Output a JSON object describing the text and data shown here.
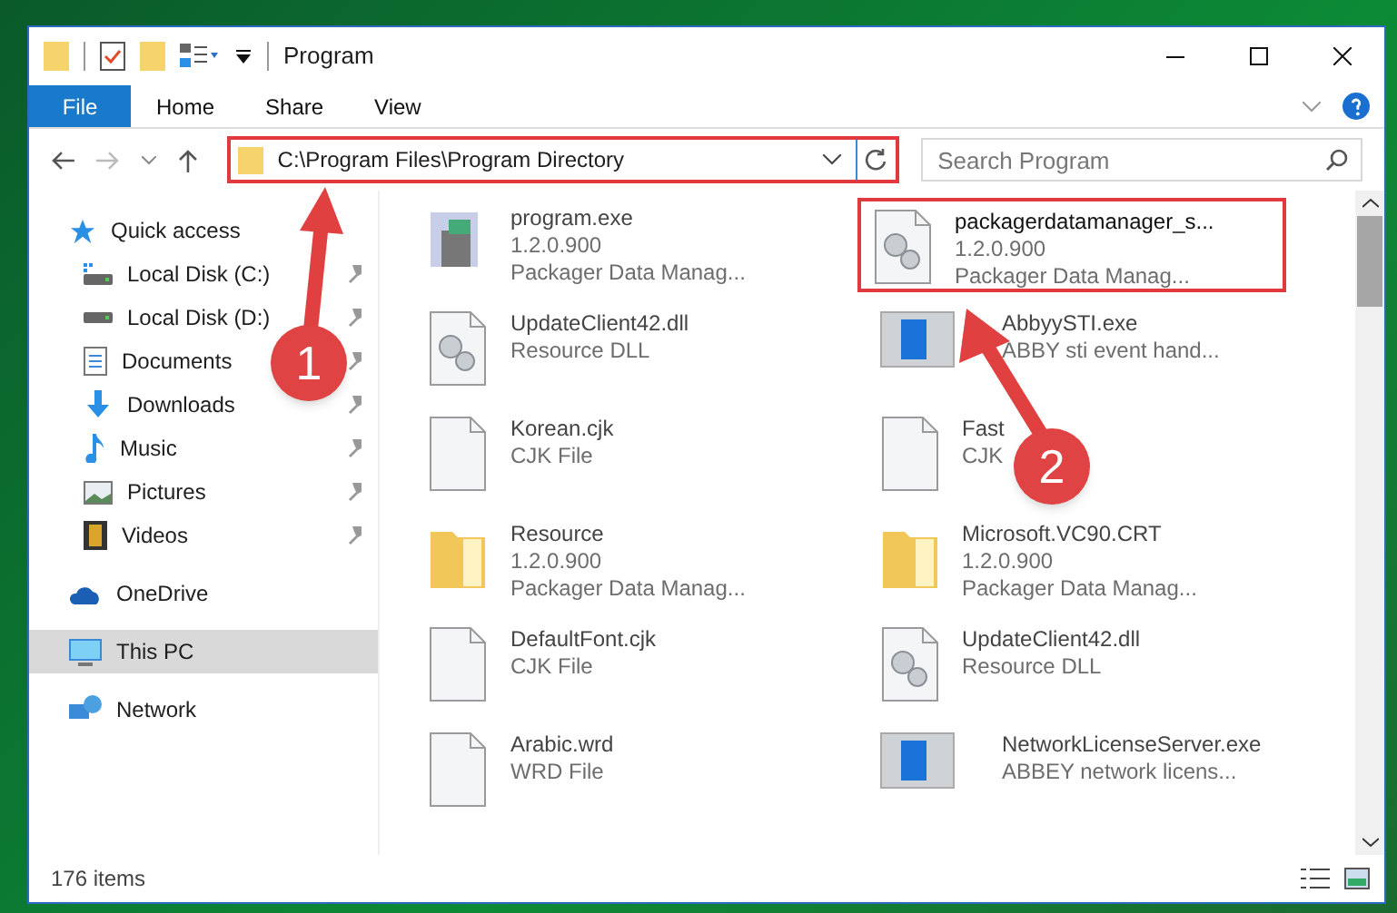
{
  "window": {
    "title": "Program"
  },
  "ribbon_tabs": [
    {
      "label": "File",
      "selected": true
    },
    {
      "label": "Home",
      "selected": false
    },
    {
      "label": "Share",
      "selected": false
    },
    {
      "label": "View",
      "selected": false
    }
  ],
  "address": {
    "value": "C:\\Program Files\\Program Directory"
  },
  "search": {
    "placeholder": "Search Program"
  },
  "sidebar": {
    "items": [
      {
        "label": "Quick access",
        "selected": false,
        "children": [
          {
            "label": "Local Disk (C:)",
            "pinned": true
          },
          {
            "label": "Local Disk (D:)",
            "pinned": true
          },
          {
            "label": "Documents",
            "pinned": true
          },
          {
            "label": "Downloads",
            "pinned": true
          },
          {
            "label": "Music",
            "pinned": true
          },
          {
            "label": "Pictures",
            "pinned": true
          },
          {
            "label": "Videos",
            "pinned": true
          }
        ]
      },
      {
        "label": "OneDrive",
        "selected": false
      },
      {
        "label": "This PC",
        "selected": true
      },
      {
        "label": "Network",
        "selected": false
      }
    ]
  },
  "files": [
    {
      "name": "program.exe",
      "lines": [
        "1.2.0.900",
        "Packager Data Manag..."
      ],
      "kind": "exe",
      "highlighted": false
    },
    {
      "name": "packagerdatamanager_s...",
      "lines": [
        "1.2.0.900",
        "Packager Data Manag..."
      ],
      "kind": "gears",
      "highlighted": true
    },
    {
      "name": "UpdateClient42.dll",
      "lines": [
        "Resource DLL"
      ],
      "kind": "dll",
      "highlighted": false
    },
    {
      "name": "AbbyySTI.exe",
      "lines": [
        "ABBY sti event hand..."
      ],
      "kind": "app",
      "highlighted": false
    },
    {
      "name": "Korean.cjk",
      "lines": [
        "CJK File"
      ],
      "kind": "file",
      "highlighted": false
    },
    {
      "name": "Fast",
      "lines": [
        "CJK"
      ],
      "kind": "file",
      "highlighted": false
    },
    {
      "name": "Resource",
      "lines": [
        "1.2.0.900",
        "Packager Data Manag..."
      ],
      "kind": "folder",
      "highlighted": false
    },
    {
      "name": "Microsoft.VC90.CRT",
      "lines": [
        "1.2.0.900",
        "Packager Data Manag..."
      ],
      "kind": "folder",
      "highlighted": false
    },
    {
      "name": "DefaultFont.cjk",
      "lines": [
        "CJK File"
      ],
      "kind": "file",
      "highlighted": false
    },
    {
      "name": "UpdateClient42.dll",
      "lines": [
        "Resource DLL"
      ],
      "kind": "dll",
      "highlighted": false
    },
    {
      "name": "Arabic.wrd",
      "lines": [
        "WRD File"
      ],
      "kind": "file",
      "highlighted": false
    },
    {
      "name": "NetworkLicenseServer.exe",
      "lines": [
        "ABBEY network licens..."
      ],
      "kind": "app",
      "highlighted": false
    }
  ],
  "status_bar": {
    "count": "176 items"
  },
  "callouts": [
    {
      "number": "1"
    },
    {
      "number": "2"
    }
  ]
}
